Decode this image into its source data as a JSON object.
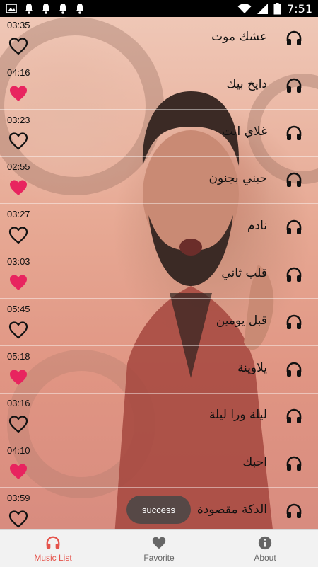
{
  "status_bar": {
    "time": "7:51"
  },
  "songs": [
    {
      "title": "عشك موت",
      "duration": "03:35",
      "favorite": false
    },
    {
      "title": "دايخ بيك",
      "duration": "04:16",
      "favorite": true
    },
    {
      "title": "غلاي انت",
      "duration": "03:23",
      "favorite": false
    },
    {
      "title": "حبني بجنون",
      "duration": "02:55",
      "favorite": true
    },
    {
      "title": "نادم",
      "duration": "03:27",
      "favorite": false
    },
    {
      "title": "قلب ثاني",
      "duration": "03:03",
      "favorite": true
    },
    {
      "title": "قبل يومين",
      "duration": "05:45",
      "favorite": false
    },
    {
      "title": "يلاوينة",
      "duration": "05:18",
      "favorite": true
    },
    {
      "title": "ليلة ورا ليلة",
      "duration": "03:16",
      "favorite": false
    },
    {
      "title": "احبك",
      "duration": "04:10",
      "favorite": true
    },
    {
      "title": "الدكة مقصودة",
      "duration": "03:59",
      "favorite": false
    }
  ],
  "toast": {
    "text": "success"
  },
  "nav": {
    "music_list": "Music List",
    "favorite": "Favorite",
    "about": "About"
  },
  "colors": {
    "accent": "#e5534b",
    "heart": "#e8245f",
    "toast_bg": "#464646"
  },
  "icons": {
    "row_play": "headphones-icon",
    "row_fav": "heart-icon"
  }
}
